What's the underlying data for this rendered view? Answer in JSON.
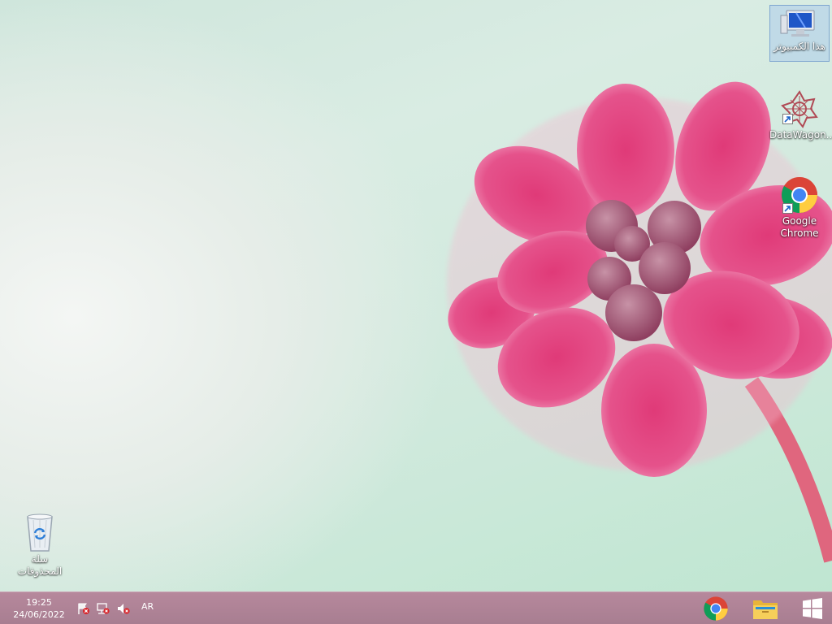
{
  "desktop": {
    "icons": {
      "this_pc": {
        "label": "هذا الكمبيوتر",
        "icon": "monitor-icon"
      },
      "datawagon": {
        "label": "DataWagon...",
        "icon": "datawagon-logo-icon"
      },
      "chrome": {
        "label": "Google\nChrome",
        "icon": "chrome-icon"
      },
      "recycle_bin": {
        "label": "سلة\nالمحذوفات",
        "icon": "recycle-bin-icon"
      }
    }
  },
  "taskbar": {
    "clock": {
      "time": "19:25",
      "date": "24/06/2022"
    },
    "language": "AR",
    "tray_icons": [
      "action-center-flag-icon",
      "network-icon",
      "volume-muted-icon"
    ],
    "pinned": [
      "chrome-icon",
      "file-explorer-icon"
    ],
    "start": "windows-start-icon"
  },
  "colors": {
    "taskbar": "#a87e91",
    "flower": "#e2447f"
  }
}
